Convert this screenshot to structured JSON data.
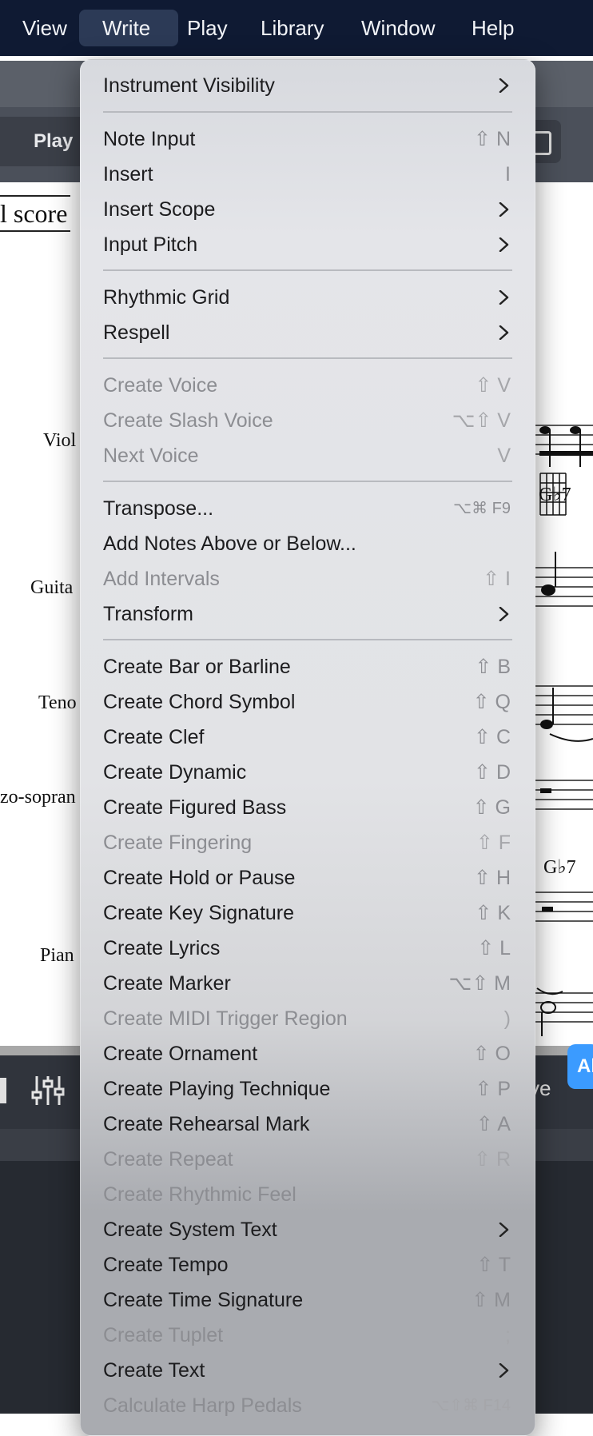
{
  "menubar": {
    "items": [
      "View",
      "Write",
      "Play",
      "Library",
      "Window",
      "Help"
    ],
    "active": "Write"
  },
  "background": {
    "play_tab": "Play",
    "score_title": "l score",
    "instruments": [
      "Viol",
      "Guita",
      "Teno",
      "zo-sopran",
      "Pian"
    ],
    "chords": [
      "G♭7",
      "G♭7"
    ],
    "live_label": "ve",
    "blue_button": "Al"
  },
  "menu": {
    "instrument_visibility": {
      "label": "Instrument Visibility",
      "submenu": true
    },
    "note_input": {
      "label": "Note Input",
      "shortcut": "⇧ N"
    },
    "insert": {
      "label": "Insert",
      "shortcut": "I"
    },
    "insert_scope": {
      "label": "Insert Scope",
      "submenu": true
    },
    "input_pitch": {
      "label": "Input Pitch",
      "submenu": true
    },
    "rhythmic_grid": {
      "label": "Rhythmic Grid",
      "submenu": true
    },
    "respell": {
      "label": "Respell",
      "submenu": true
    },
    "create_voice": {
      "label": "Create Voice",
      "shortcut": "⇧ V",
      "disabled": true
    },
    "create_slash_voice": {
      "label": "Create Slash Voice",
      "shortcut": "⌥⇧ V",
      "disabled": true
    },
    "next_voice": {
      "label": "Next Voice",
      "shortcut": "V",
      "disabled": true
    },
    "transpose": {
      "label": "Transpose...",
      "shortcut": "⌥⌘ F9"
    },
    "add_notes": {
      "label": "Add Notes Above or Below..."
    },
    "add_intervals": {
      "label": "Add Intervals",
      "shortcut": "⇧ I",
      "disabled": true
    },
    "transform": {
      "label": "Transform",
      "submenu": true
    },
    "create_bar": {
      "label": "Create Bar or Barline",
      "shortcut": "⇧ B"
    },
    "create_chord_symbol": {
      "label": "Create Chord Symbol",
      "shortcut": "⇧ Q"
    },
    "create_clef": {
      "label": "Create Clef",
      "shortcut": "⇧ C"
    },
    "create_dynamic": {
      "label": "Create Dynamic",
      "shortcut": "⇧ D"
    },
    "create_figured_bass": {
      "label": "Create Figured Bass",
      "shortcut": "⇧ G"
    },
    "create_fingering": {
      "label": "Create Fingering",
      "shortcut": "⇧ F",
      "disabled": true
    },
    "create_hold": {
      "label": "Create Hold or Pause",
      "shortcut": "⇧ H"
    },
    "create_key_signature": {
      "label": "Create Key Signature",
      "shortcut": "⇧ K"
    },
    "create_lyrics": {
      "label": "Create Lyrics",
      "shortcut": "⇧ L"
    },
    "create_marker": {
      "label": "Create Marker",
      "shortcut": "⌥⇧ M"
    },
    "create_midi_trigger": {
      "label": "Create MIDI Trigger Region",
      "shortcut": ")",
      "disabled": true
    },
    "create_ornament": {
      "label": "Create Ornament",
      "shortcut": "⇧ O"
    },
    "create_playing_technique": {
      "label": "Create Playing Technique",
      "shortcut": "⇧ P"
    },
    "create_rehearsal_mark": {
      "label": "Create Rehearsal Mark",
      "shortcut": "⇧ A"
    },
    "create_repeat": {
      "label": "Create Repeat",
      "shortcut": "⇧ R",
      "disabled": true
    },
    "create_rhythmic_feel": {
      "label": "Create Rhythmic Feel",
      "disabled": true
    },
    "create_system_text": {
      "label": "Create System Text",
      "submenu": true
    },
    "create_tempo": {
      "label": "Create Tempo",
      "shortcut": "⇧ T"
    },
    "create_time_signature": {
      "label": "Create Time Signature",
      "shortcut": "⇧ M"
    },
    "create_tuplet": {
      "label": "Create Tuplet",
      "shortcut": ";",
      "disabled": true
    },
    "create_text": {
      "label": "Create Text",
      "submenu": true
    },
    "calculate_harp_pedals": {
      "label": "Calculate Harp Pedals",
      "shortcut": "⌥⇧⌘ F14",
      "disabled": true
    }
  }
}
